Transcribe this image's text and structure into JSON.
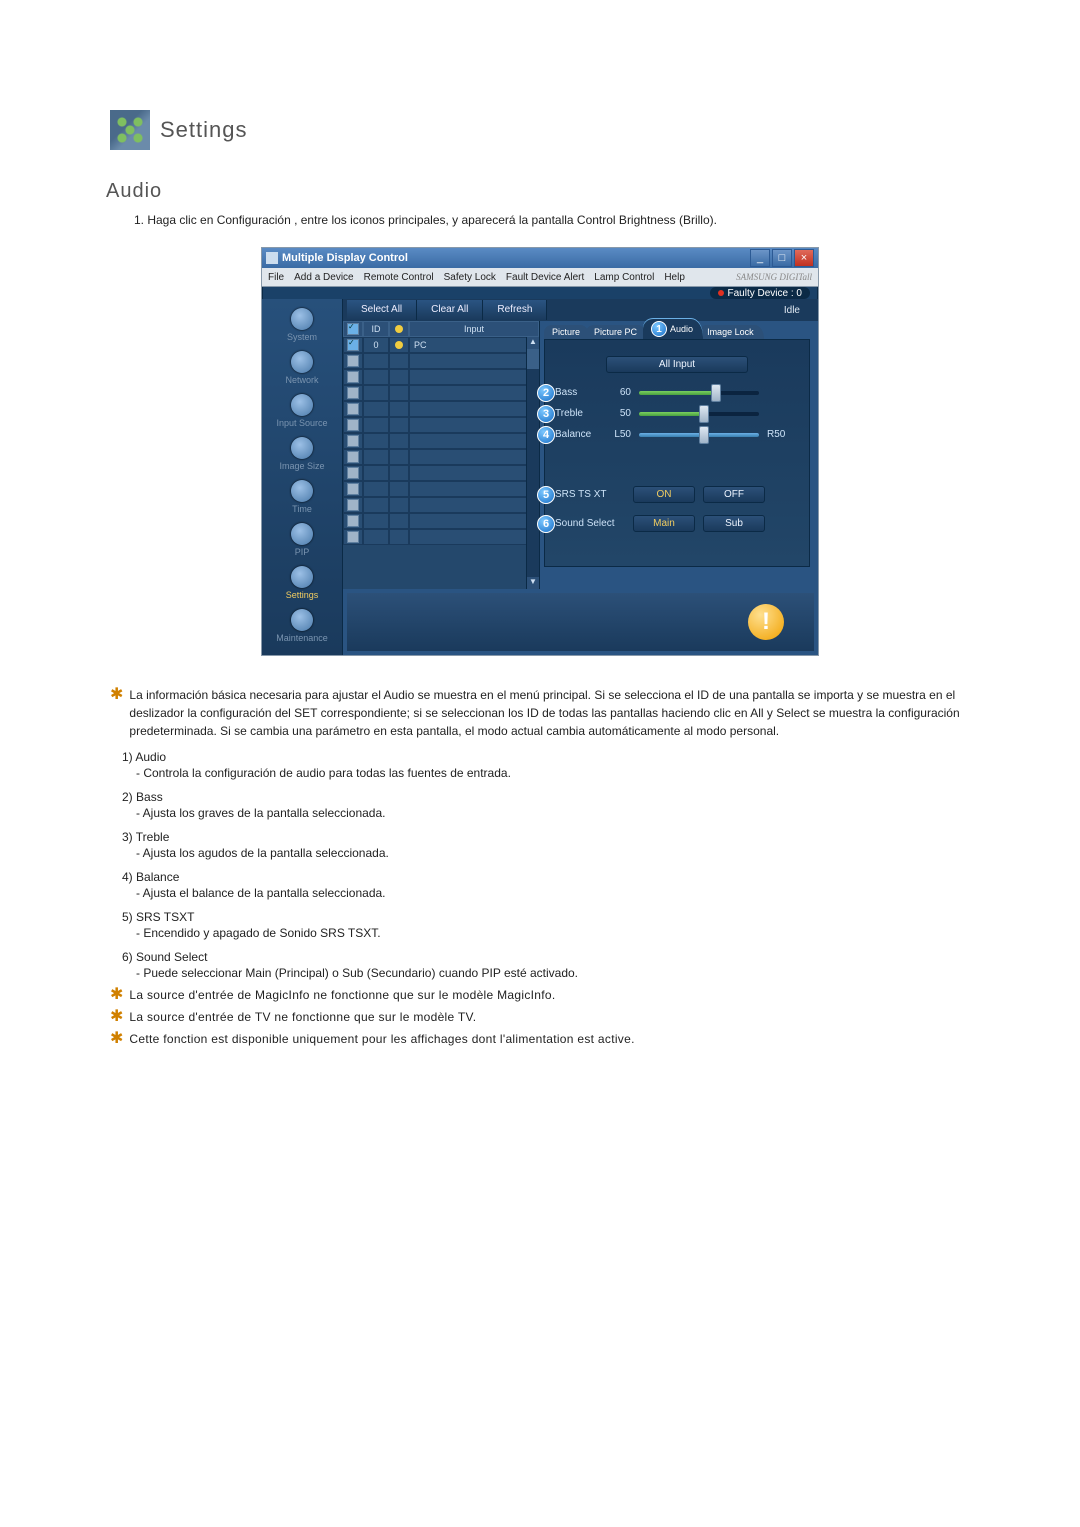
{
  "section": {
    "title": "Settings",
    "sub": "Audio",
    "intro": "1. Haga clic en Configuración , entre los iconos principales, y aparecerá la pantalla Control Brightness (Brillo)."
  },
  "app": {
    "title": "Multiple Display Control",
    "brand": "SAMSUNG DIGITall",
    "menus": [
      "File",
      "Add a Device",
      "Remote Control",
      "Safety Lock",
      "Fault Device Alert",
      "Lamp Control",
      "Help"
    ],
    "faulty_label": "Faulty Device : 0",
    "toolbar": {
      "select_all": "Select All",
      "clear_all": "Clear All",
      "refresh": "Refresh",
      "idle": "Idle"
    },
    "sidebar": [
      {
        "label": "System"
      },
      {
        "label": "Network"
      },
      {
        "label": "Input Source"
      },
      {
        "label": "Image Size"
      },
      {
        "label": "Time"
      },
      {
        "label": "PIP"
      },
      {
        "label": "Settings"
      },
      {
        "label": "Maintenance"
      }
    ],
    "grid": {
      "headers": {
        "id_col": "ID",
        "input_col": "Input"
      },
      "row0": {
        "id": "0",
        "input": "PC"
      }
    },
    "tabs": {
      "picture": "Picture",
      "picture_pc": "Picture PC",
      "audio": "Audio",
      "image_lock": "Image Lock"
    },
    "panel": {
      "all_input": "All Input",
      "bass": {
        "label": "Bass",
        "value": "60"
      },
      "treble": {
        "label": "Treble",
        "value": "50"
      },
      "balance": {
        "label": "Balance",
        "left": "L50",
        "right": "R50"
      },
      "srs": {
        "label": "SRS TS XT",
        "on": "ON",
        "off": "OFF"
      },
      "sound_select": {
        "label": "Sound Select",
        "main": "Main",
        "sub": "Sub"
      }
    }
  },
  "notes": {
    "star1": "La información básica necesaria para ajustar el Audio se muestra en el menú principal. Si se selecciona el ID de una pantalla se importa y se muestra en el deslizador la configuración del SET correspondiente; si se seleccionan los ID de todas las pantallas haciendo clic en All y Select se muestra la configuración predeterminada. Si se cambia una parámetro en esta pantalla, el modo actual cambia automáticamente al modo personal.",
    "items": [
      {
        "num": "1)",
        "name": "Audio",
        "desc": "- Controla la configuración de audio para todas las fuentes de entrada."
      },
      {
        "num": "2)",
        "name": "Bass",
        "desc": "- Ajusta los graves de la pantalla seleccionada."
      },
      {
        "num": "3)",
        "name": "Treble",
        "desc": "- Ajusta los agudos de la pantalla seleccionada."
      },
      {
        "num": "4)",
        "name": "Balance",
        "desc": "- Ajusta el balance de la pantalla seleccionada."
      },
      {
        "num": "5)",
        "name": "SRS TSXT",
        "desc": "- Encendido y apagado de Sonido SRS TSXT."
      },
      {
        "num": "6)",
        "name": "Sound Select",
        "desc": "- Puede seleccionar Main (Principal) o Sub (Secundario) cuando PIP esté activado."
      }
    ],
    "star2": "La source d'entrée de MagicInfo ne fonctionne que sur le modèle MagicInfo.",
    "star3": "La source d'entrée de TV ne fonctionne que sur le modèle TV.",
    "star4": "Cette fonction est disponible uniquement pour les affichages dont l'alimentation est active."
  }
}
